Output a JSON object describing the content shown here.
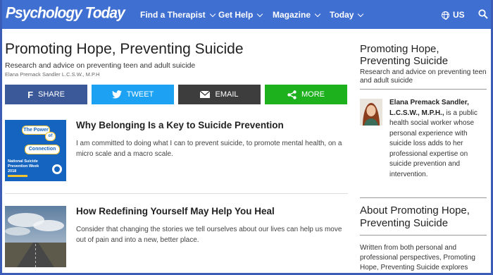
{
  "header": {
    "logo": "Psychology Today",
    "nav": [
      {
        "label": "Find a Therapist"
      },
      {
        "label": "Get Help"
      },
      {
        "label": "Magazine"
      },
      {
        "label": "Today"
      }
    ],
    "locale": "US",
    "colors": {
      "nav_bg": "#3f6fd1"
    }
  },
  "blog": {
    "title": "Promoting Hope, Preventing Suicide",
    "subtitle": "Research and advice on preventing teen and adult suicide",
    "author": "Elana Premack Sandler L.C.S.W., M.P.H"
  },
  "share": [
    {
      "label": "Share",
      "icon": "facebook-icon",
      "color": "#3b5998"
    },
    {
      "label": "Tweet",
      "icon": "twitter-icon",
      "color": "#1da1f2"
    },
    {
      "label": "Email",
      "icon": "envelope-icon",
      "color": "#3d3d3d"
    },
    {
      "label": "More",
      "icon": "share-icon",
      "color": "#1db21d"
    }
  ],
  "articles": [
    {
      "title": "Why Belonging Is a Key to Suicide Prevention",
      "summary": "I am committed to doing what I can to prevent suicide, to promote mental health, on a micro scale and a macro scale.",
      "thumb": {
        "bubble1": "The Power",
        "bubble2": "of",
        "bubble3": "Connection",
        "caption": "National Suicide Prevention Week 2018"
      }
    },
    {
      "title": "How Redefining Yourself May Help You Heal",
      "summary": "Consider that changing the stories we tell ourselves about our lives can help us move out of pain and into a new, better place."
    }
  ],
  "sidebar": {
    "title": "Promoting Hope, Preventing Suicide",
    "subtitle": "Research and advice on preventing teen and adult suicide",
    "bio_name": "Elana Premack Sandler, L.C.S.W., M.P.H.,",
    "bio_text": " is a public health social worker whose personal experience with suicide loss adds to her professional expertise on suicide prevention and intervention.",
    "about_title": "About Promoting Hope, Preventing Suicide",
    "about_body": "Written from both personal and professional perspectives, Promoting Hope, Preventing Suicide explores"
  }
}
